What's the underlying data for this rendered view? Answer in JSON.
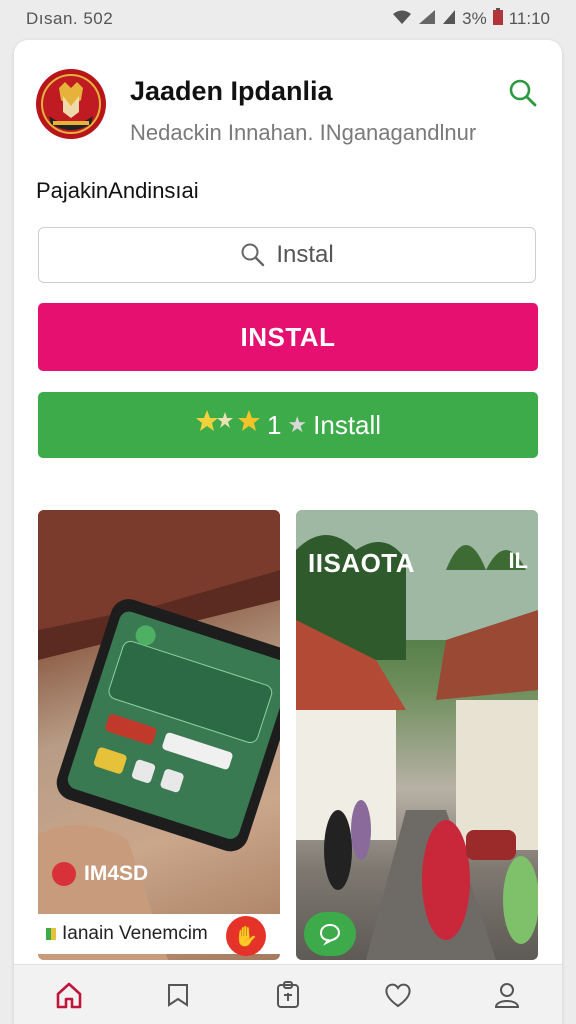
{
  "status_bar": {
    "left_text": "Dısan. 502",
    "battery": "3%",
    "time": "11:10"
  },
  "header": {
    "title": "Jaaden Ipdanlia",
    "subtitle": "Nedackin Innahan. INganagandlnur"
  },
  "section_label": "PajakinAndinsıai",
  "search": {
    "placeholder": "Instal"
  },
  "buttons": {
    "primary_label": "INSTAL",
    "secondary_label": "Install",
    "secondary_rating": "1",
    "primary_color": "#e5106f",
    "secondary_color": "#3dab4a"
  },
  "tiles": {
    "left_overlay": "IM4SD",
    "right_overlay": "IISAOTA",
    "right_badge": "IL",
    "caption": "Ianain Venemcim"
  },
  "nav": {
    "items": [
      "home-icon",
      "bookmark-icon",
      "clipboard-icon",
      "heart-icon",
      "profile-icon"
    ]
  }
}
